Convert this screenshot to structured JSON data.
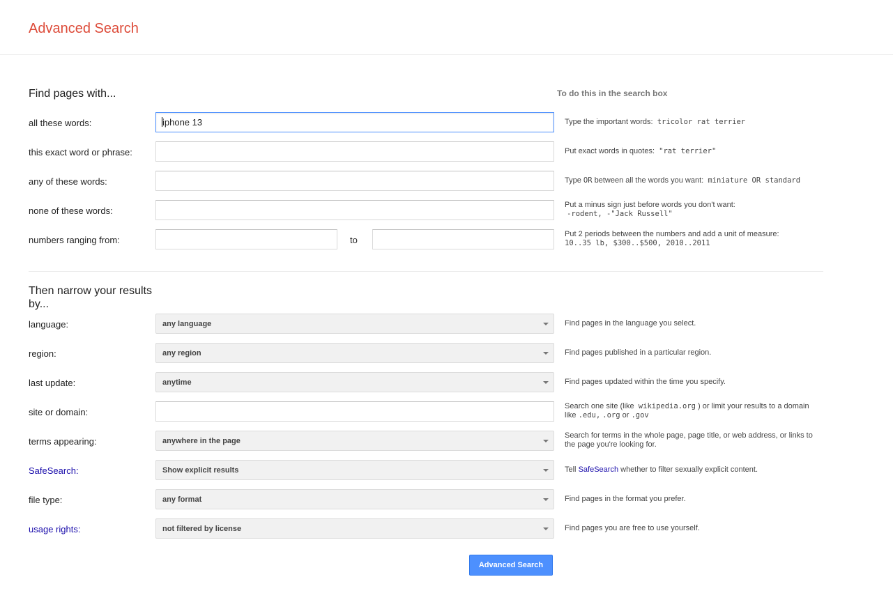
{
  "header": {
    "title": "Advanced Search"
  },
  "find_section": {
    "title": "Find pages with...",
    "hint_title": "To do this in the search box",
    "all_words": {
      "label": "all these words:",
      "value": "iphone 13",
      "hint_text": "Type the important words:",
      "hint_example": "tricolor rat terrier"
    },
    "exact_phrase": {
      "label": "this exact word or phrase:",
      "value": "",
      "hint_text": "Put exact words in quotes:",
      "hint_example": "\"rat terrier\""
    },
    "any_words": {
      "label": "any of these words:",
      "value": "",
      "hint_pre": "Type",
      "hint_or": "OR",
      "hint_text": "between all the words you want:",
      "hint_example": "miniature OR standard"
    },
    "none_words": {
      "label": "none of these words:",
      "value": "",
      "hint_text": "Put a minus sign just before words you don't want:",
      "hint_example": "-rodent, -\"Jack Russell\""
    },
    "numbers": {
      "label": "numbers ranging from:",
      "from_value": "",
      "to_label": "to",
      "to_value": "",
      "hint_text": "Put 2 periods between the numbers and add a unit of measure:",
      "hint_example": "10..35 lb, $300..$500, 2010..2011"
    }
  },
  "narrow_section": {
    "title": "Then narrow your results by...",
    "language": {
      "label": "language:",
      "selected": "any language",
      "hint": "Find pages in the language you select."
    },
    "region": {
      "label": "region:",
      "selected": "any region",
      "hint": "Find pages published in a particular region."
    },
    "last_update": {
      "label": "last update:",
      "selected": "anytime",
      "hint": "Find pages updated within the time you specify."
    },
    "site": {
      "label": "site or domain:",
      "value": "",
      "hint_pre": "Search one site (like",
      "hint_example": "wikipedia.org",
      "hint_mid": ") or limit your results to a domain like",
      "hint_edu": ".edu,",
      "hint_org": ".org",
      "hint_or": "or",
      "hint_gov": ".gov"
    },
    "terms": {
      "label": "terms appearing:",
      "selected": "anywhere in the page",
      "hint": "Search for terms in the whole page, page title, or web address, or links to the page you're looking for."
    },
    "safesearch": {
      "label_link": "SafeSearch",
      "label_suffix": ":",
      "selected": "Show explicit results",
      "hint_pre": "Tell",
      "hint_link": "SafeSearch",
      "hint_post": "whether to filter sexually explicit content."
    },
    "file_type": {
      "label": "file type:",
      "selected": "any format",
      "hint": "Find pages in the format you prefer."
    },
    "usage_rights": {
      "label_link": "usage rights",
      "label_suffix": ":",
      "selected": "not filtered by license",
      "hint": "Find pages you are free to use yourself."
    }
  },
  "submit": {
    "label": "Advanced Search"
  },
  "colors": {
    "title": "#dd4b39",
    "link": "#1a0dab",
    "button": "#4d90fe",
    "focus_border": "#4d90fe"
  }
}
